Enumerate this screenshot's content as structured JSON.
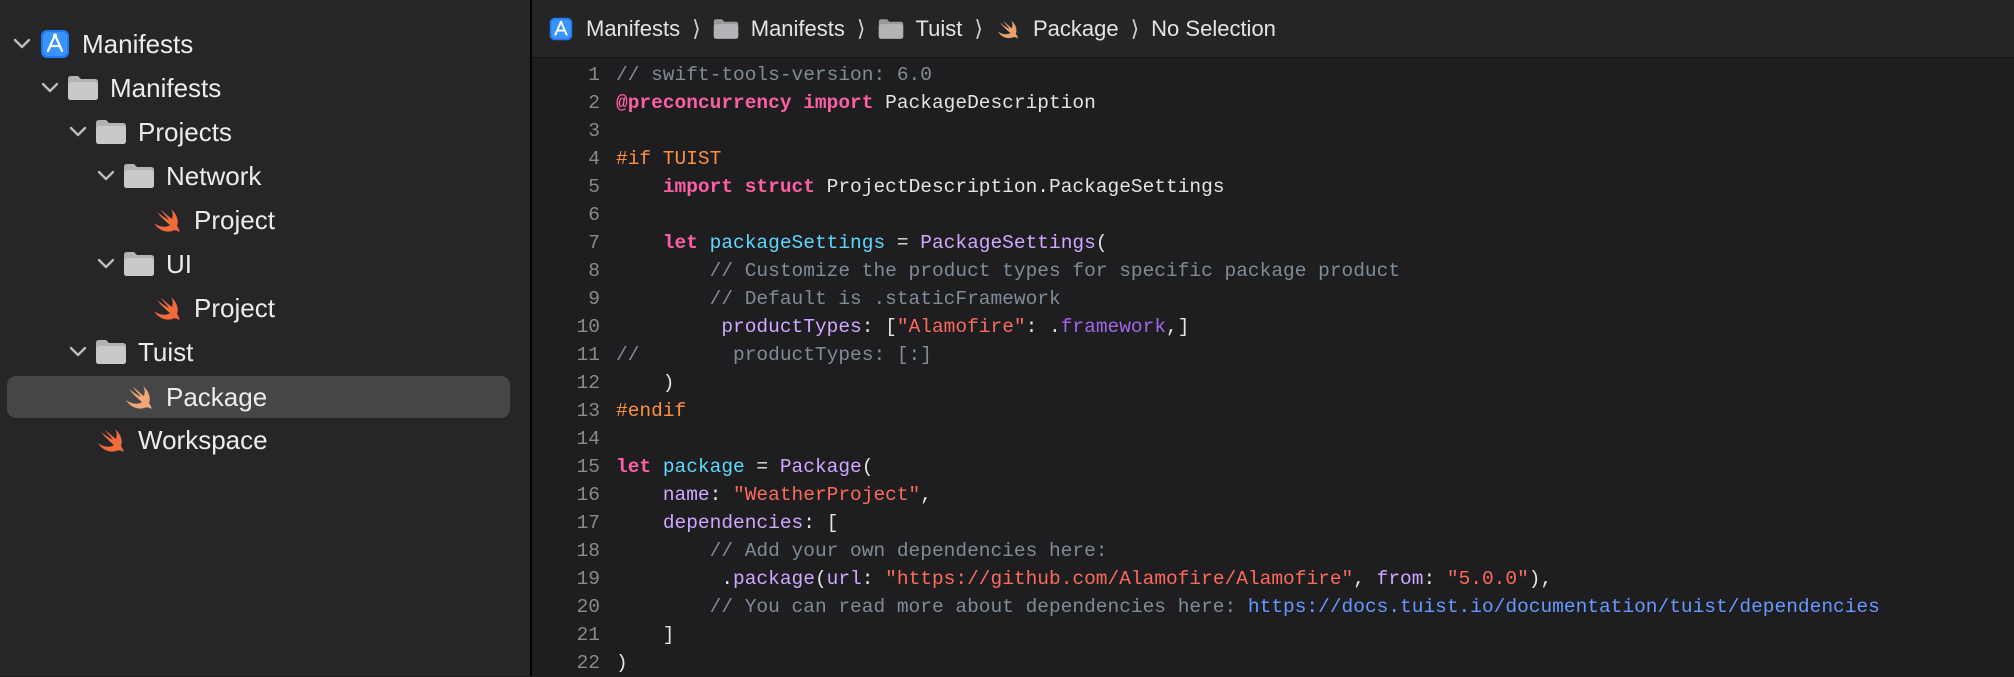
{
  "sidebar": {
    "items": [
      {
        "label": "Manifests",
        "icon": "app-project-icon",
        "expanded": true
      },
      {
        "label": "Manifests",
        "icon": "folder-icon",
        "expanded": true
      },
      {
        "label": "Projects",
        "icon": "folder-icon",
        "expanded": true
      },
      {
        "label": "Network",
        "icon": "folder-icon",
        "expanded": true
      },
      {
        "label": "Project",
        "icon": "swift-file-icon"
      },
      {
        "label": "UI",
        "icon": "folder-icon",
        "expanded": true
      },
      {
        "label": "Project",
        "icon": "swift-file-icon"
      },
      {
        "label": "Tuist",
        "icon": "folder-icon",
        "expanded": true
      },
      {
        "label": "Package",
        "icon": "swift-file-icon",
        "selected": true
      },
      {
        "label": "Workspace",
        "icon": "swift-file-icon"
      }
    ]
  },
  "breadcrumb": {
    "items": [
      {
        "label": "Manifests",
        "icon": "app-project-icon"
      },
      {
        "label": "Manifests",
        "icon": "folder-icon"
      },
      {
        "label": "Tuist",
        "icon": "folder-icon"
      },
      {
        "label": "Package",
        "icon": "swift-file-icon"
      },
      {
        "label": "No Selection",
        "icon": ""
      }
    ],
    "separator": "⟩"
  },
  "colors": {
    "accent": "#0a84ff",
    "swift": "#f05138",
    "keyword": "#fc5fa3",
    "string": "#fc6a5d",
    "comment": "#7f8c98",
    "preprocessor": "#fd8f3f",
    "url": "#6699ff"
  },
  "code": {
    "lines": [
      {
        "n": "1",
        "tokens": [
          [
            "cm",
            "// swift-tools-version: 6.0"
          ]
        ]
      },
      {
        "n": "2",
        "tokens": [
          [
            "kw",
            "@preconcurrency"
          ],
          [
            "pl",
            " "
          ],
          [
            "kw",
            "import"
          ],
          [
            "pl",
            " PackageDescription"
          ]
        ]
      },
      {
        "n": "3",
        "tokens": []
      },
      {
        "n": "4",
        "tokens": [
          [
            "pp",
            "#if TUIST"
          ]
        ]
      },
      {
        "n": "5",
        "tokens": [
          [
            "pl",
            "    "
          ],
          [
            "kw",
            "import"
          ],
          [
            "pl",
            " "
          ],
          [
            "kw",
            "struct"
          ],
          [
            "pl",
            " ProjectDescription.PackageSettings"
          ]
        ]
      },
      {
        "n": "6",
        "tokens": []
      },
      {
        "n": "7",
        "tokens": [
          [
            "pl",
            "    "
          ],
          [
            "kw",
            "let"
          ],
          [
            "pl",
            " "
          ],
          [
            "id",
            "packageSettings"
          ],
          [
            "pl",
            " = "
          ],
          [
            "ty",
            "PackageSettings"
          ],
          [
            "pl",
            "("
          ]
        ]
      },
      {
        "n": "8",
        "tokens": [
          [
            "pl",
            "        "
          ],
          [
            "cm",
            "// Customize the product types for specific package product"
          ]
        ]
      },
      {
        "n": "9",
        "tokens": [
          [
            "pl",
            "        "
          ],
          [
            "cm",
            "// Default is .staticFramework"
          ]
        ]
      },
      {
        "n": "10",
        "tokens": [
          [
            "pl",
            "         "
          ],
          [
            "ty",
            "productTypes"
          ],
          [
            "pl",
            ": ["
          ],
          [
            "str",
            "\"Alamofire\""
          ],
          [
            "pl",
            ": ."
          ],
          [
            "fn",
            "framework"
          ],
          [
            "pl",
            ",]"
          ]
        ]
      },
      {
        "n": "11",
        "tokens": [
          [
            "cm",
            "//        productTypes: [:]"
          ]
        ]
      },
      {
        "n": "12",
        "tokens": [
          [
            "pl",
            "    )"
          ]
        ]
      },
      {
        "n": "13",
        "tokens": [
          [
            "pp",
            "#endif"
          ]
        ]
      },
      {
        "n": "14",
        "tokens": []
      },
      {
        "n": "15",
        "tokens": [
          [
            "kw",
            "let"
          ],
          [
            "pl",
            " "
          ],
          [
            "id",
            "package"
          ],
          [
            "pl",
            " = "
          ],
          [
            "ty",
            "Package"
          ],
          [
            "pl",
            "("
          ]
        ]
      },
      {
        "n": "16",
        "tokens": [
          [
            "pl",
            "    "
          ],
          [
            "ty",
            "name"
          ],
          [
            "pl",
            ": "
          ],
          [
            "str",
            "\"WeatherProject\""
          ],
          [
            "pl",
            ","
          ]
        ]
      },
      {
        "n": "17",
        "tokens": [
          [
            "pl",
            "    "
          ],
          [
            "ty",
            "dependencies"
          ],
          [
            "pl",
            ": ["
          ]
        ]
      },
      {
        "n": "18",
        "tokens": [
          [
            "pl",
            "        "
          ],
          [
            "cm",
            "// Add your own dependencies here:"
          ]
        ]
      },
      {
        "n": "19",
        "tokens": [
          [
            "pl",
            "         ."
          ],
          [
            "ty",
            "package"
          ],
          [
            "pl",
            "("
          ],
          [
            "ty",
            "url"
          ],
          [
            "pl",
            ": "
          ],
          [
            "str",
            "\"https://github.com/Alamofire/Alamofire\""
          ],
          [
            "pl",
            ", "
          ],
          [
            "ty",
            "from"
          ],
          [
            "pl",
            ": "
          ],
          [
            "str",
            "\"5.0.0\""
          ],
          [
            "pl",
            "),"
          ]
        ]
      },
      {
        "n": "20",
        "tokens": [
          [
            "pl",
            "        "
          ],
          [
            "cm",
            "// You can read more about dependencies here: "
          ],
          [
            "url",
            "https://docs.tuist.io/documentation/tuist/dependencies"
          ]
        ]
      },
      {
        "n": "21",
        "tokens": [
          [
            "pl",
            "    ]"
          ]
        ]
      },
      {
        "n": "22",
        "tokens": [
          [
            "pl",
            ")"
          ]
        ]
      }
    ]
  }
}
